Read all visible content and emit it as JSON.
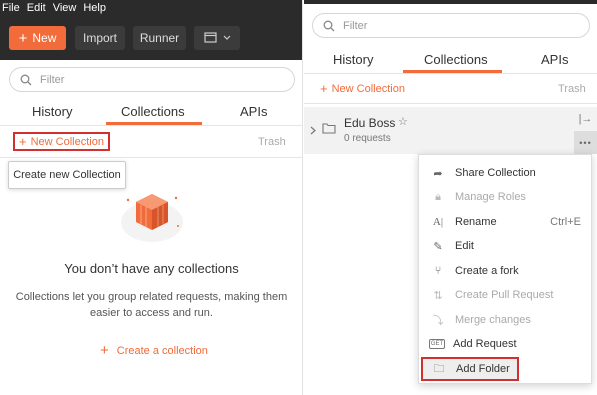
{
  "left": {
    "menu": [
      "File",
      "Edit",
      "View",
      "Help"
    ],
    "toolbar": {
      "new_label": "New",
      "import_label": "Import",
      "runner_label": "Runner"
    },
    "filter_placeholder": "Filter",
    "tabs": [
      "History",
      "Collections",
      "APIs"
    ],
    "new_collection_label": "New Collection",
    "trash_label": "Trash",
    "tooltip": "Create new Collection",
    "empty_title": "You don’t have any collections",
    "empty_desc_line1": "Collections let you group related requests, making them",
    "empty_desc_line2": "easier to access and run.",
    "create_link": "Create a collection"
  },
  "right": {
    "filter_placeholder": "Filter",
    "tabs": [
      "History",
      "Collections",
      "APIs"
    ],
    "new_collection_label": "New Collection",
    "trash_label": "Trash",
    "collection": {
      "name": "Edu Boss",
      "count": "0 requests"
    },
    "context_menu": [
      {
        "label": "Share Collection",
        "icon": "share-icon",
        "disabled": false
      },
      {
        "label": "Manage Roles",
        "icon": "lock-icon",
        "disabled": true
      },
      {
        "label": "Rename",
        "icon": "rename-icon",
        "disabled": false,
        "shortcut": "Ctrl+E"
      },
      {
        "label": "Edit",
        "icon": "pencil-icon",
        "disabled": false
      },
      {
        "label": "Create a fork",
        "icon": "fork-icon",
        "disabled": false
      },
      {
        "label": "Create Pull Request",
        "icon": "pull-request-icon",
        "disabled": true
      },
      {
        "label": "Merge changes",
        "icon": "merge-icon",
        "disabled": true
      },
      {
        "label": "Add Request",
        "icon": "get-request-icon",
        "disabled": false
      },
      {
        "label": "Add Folder",
        "icon": "folder-add-icon",
        "disabled": false
      }
    ]
  },
  "colors": {
    "accent": "#f26b3a",
    "highlight": "#d32f2f",
    "dark_bar": "#2b2b2b"
  }
}
